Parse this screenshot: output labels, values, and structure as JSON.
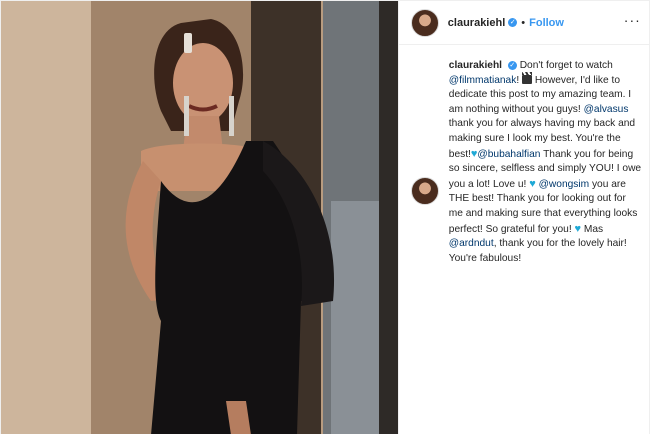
{
  "header": {
    "username": "claurakiehl",
    "verified_icon": "verified-badge-icon",
    "separator": "•",
    "follow_label": "Follow",
    "more_icon": "more-options-icon",
    "more_label": "···"
  },
  "caption": {
    "username": "claurakiehl",
    "parts": [
      {
        "type": "text",
        "value": " Don't forget to watch "
      },
      {
        "type": "mention",
        "value": "@filmmatianak"
      },
      {
        "type": "text",
        "value": "! "
      },
      {
        "type": "emoji",
        "value": "clapperboard"
      },
      {
        "type": "text",
        "value": " However, I'd like to dedicate this post to my amazing team. I am nothing without you guys! "
      },
      {
        "type": "mention",
        "value": "@alvasus"
      },
      {
        "type": "text",
        "value": " thank you for always having my back and making sure I look my best. You're the best!"
      },
      {
        "type": "emoji",
        "value": "blue-heart"
      },
      {
        "type": "mention",
        "value": "@bubahalfian"
      },
      {
        "type": "text",
        "value": " Thank you for being so sincere, selfless and simply YOU! I owe you a lot! Love u! "
      },
      {
        "type": "emoji",
        "value": "blue-heart"
      },
      {
        "type": "text",
        "value": " "
      },
      {
        "type": "mention",
        "value": "@wongsim"
      },
      {
        "type": "text",
        "value": " you are THE best! Thank you for looking out for me and making sure that everything looks perfect! So grateful for you! "
      },
      {
        "type": "emoji",
        "value": "blue-heart"
      },
      {
        "type": "text",
        "value": " Mas "
      },
      {
        "type": "mention",
        "value": "@ardndut"
      },
      {
        "type": "text",
        "value": ", thank you for the lovely hair! You're fabulous!"
      }
    ]
  },
  "colors": {
    "link_blue": "#3897f0",
    "mention": "#00376b",
    "heart": "#1fa9d6",
    "text": "#262626",
    "border": "#efefef"
  }
}
